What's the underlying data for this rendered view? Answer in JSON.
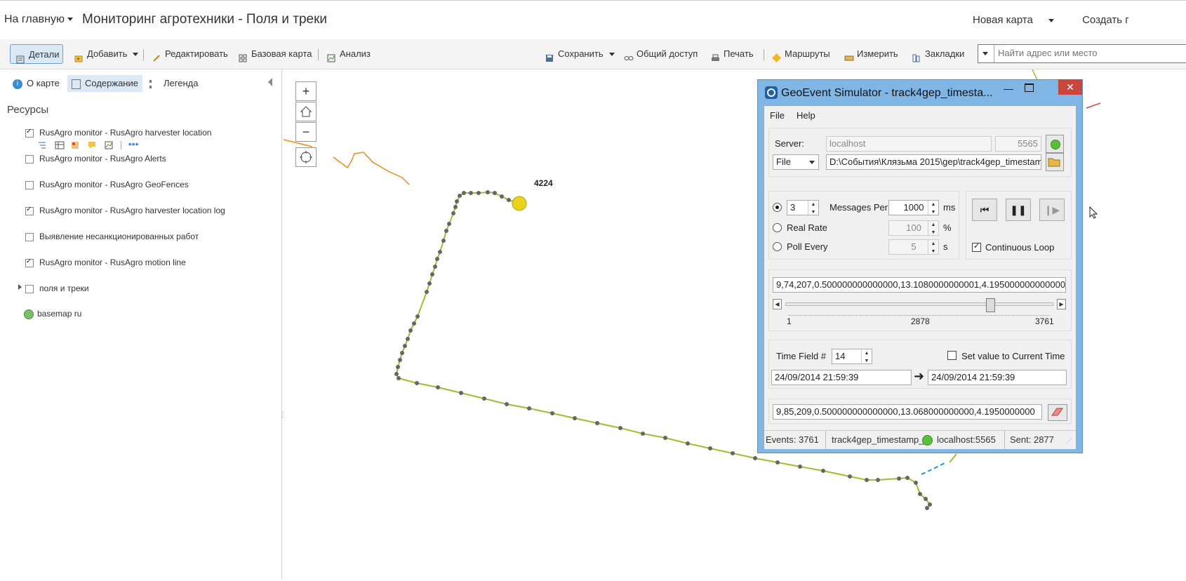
{
  "header": {
    "home_label": "На главную",
    "title": "Мониторинг агротехники - Поля и треки",
    "new_map_label": "Новая карта",
    "create_label": "Создать г"
  },
  "toolbar": {
    "details": "Детали",
    "add": "Добавить",
    "edit": "Редактировать",
    "basemap": "Базовая карта",
    "analysis": "Анализ",
    "save": "Сохранить",
    "share": "Общий доступ",
    "print": "Печать",
    "routes": "Маршруты",
    "measure": "Измерить",
    "bookmarks": "Закладки",
    "search_placeholder": "Найти адрес или место"
  },
  "sidebar": {
    "tabs": [
      "О карте",
      "Содержание",
      "Легенда"
    ],
    "resources_title": "Ресурсы",
    "layers": [
      {
        "label": "RusAgro monitor - RusAgro harvester location",
        "checked": true
      },
      {
        "label": "RusAgro monitor - RusAgro Alerts",
        "checked": false
      },
      {
        "label": "RusAgro monitor - RusAgro GeoFences",
        "checked": false
      },
      {
        "label": "RusAgro monitor - RusAgro harvester location log",
        "checked": true
      },
      {
        "label": "Выявление несанкционированных работ",
        "checked": false
      },
      {
        "label": "RusAgro monitor - RusAgro motion line",
        "checked": true
      },
      {
        "label": "поля и треки",
        "checked": false
      }
    ],
    "basemap_label": "basemap ru"
  },
  "map": {
    "zoom_in": "+",
    "zoom_out": "−",
    "point_label": "4224"
  },
  "simulator": {
    "title": "GeoEvent Simulator - track4gep_timesta...",
    "menu": [
      "File",
      "Help"
    ],
    "server_label": "Server:",
    "server_value": "localhost",
    "port_value": "5565",
    "source_type": "File",
    "file_path": "D:\\События\\Клязьма 2015\\gep\\track4gep_timestam",
    "messages_count": "3",
    "messages_per_label": "Messages Per",
    "messages_interval": "1000",
    "ms_label": "ms",
    "real_rate_label": "Real Rate",
    "real_rate_value": "100",
    "percent_label": "%",
    "poll_every_label": "Poll Every",
    "poll_value": "5",
    "s_label": "s",
    "continuous_loop_label": "Continuous Loop",
    "continuous_loop": true,
    "current_line": "9,74,207,0.500000000000000,13.1080000000001,4.195000000000000",
    "slider_min": "1",
    "slider_current": "2878",
    "slider_max": "3761",
    "slider_position": 0.765,
    "time_field_label": "Time Field #",
    "time_field_value": "14",
    "set_current_time_label": "Set value to Current Time",
    "time_from": "24/09/2014 21:59:39",
    "time_to": "24/09/2014 21:59:39",
    "sent_line": "9,85,209,0.500000000000000,13.068000000000,4.1950000000",
    "status": {
      "events": "Events: 3761",
      "file": "track4gep_timestamp_",
      "server": "localhost:5565",
      "sent": "Sent: 2877"
    }
  },
  "colors": {
    "track_line": "#9dbf2e",
    "track_point": "#666666",
    "orange_line": "#f0891e",
    "current_point": "#e8d31a",
    "window_frame": "#7fb6e6",
    "close_button": "#c9463d"
  }
}
